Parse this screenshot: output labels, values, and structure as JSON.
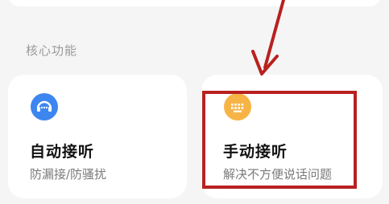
{
  "section": {
    "title": "核心功能"
  },
  "cards": [
    {
      "title": "自动接听",
      "subtitle": "防漏接/防骚扰",
      "icon": "headset-icon",
      "icon_color": "#3d86f0"
    },
    {
      "title": "手动接听",
      "subtitle": "解决不方便说话问题",
      "icon": "keyboard-icon",
      "icon_color": "#f7b446"
    }
  ],
  "annotation": {
    "color": "#b8211f"
  }
}
